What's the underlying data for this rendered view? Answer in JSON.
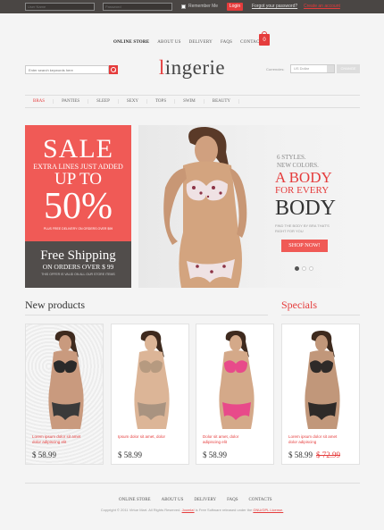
{
  "login_bar": {
    "username_placeholder": "User Name",
    "password_placeholder": "Password",
    "remember_label": "Remember Me",
    "login_label": "Login",
    "forgot_label": "Forgot your password?",
    "create_label": "Create an account"
  },
  "top_nav": {
    "items": [
      "ONLINE STORE",
      "ABOUT US",
      "DELIVERY",
      "FAQS",
      "CONTACTS"
    ],
    "cart_count": "0"
  },
  "search": {
    "placeholder": "Enter search keywords here"
  },
  "logo": {
    "first_letter": "l",
    "rest": "ingerie"
  },
  "currency": {
    "label": "Currencies:",
    "selected": "US Dollar",
    "button": "CHANGE"
  },
  "categories": [
    "BRAS",
    "PANTIES",
    "SLEEP",
    "SEXY",
    "TOPS",
    "SWIM",
    "BEAUTY"
  ],
  "promo_sale": {
    "sale": "SALE",
    "extra": "EXTRA LINES JUST ADDED",
    "upto": "UP TO",
    "percent": "50%",
    "fine": "PLUS FREE DELIVERY ON ORDERS OVER $99"
  },
  "promo_shipping": {
    "title": "Free Shipping",
    "orders": "ON ORDERS OVER $ 99",
    "fine": "THIS OFFER IS VALID ON ALL OUR STORE ITEMS"
  },
  "slider": {
    "styles": "6 STYLES.",
    "colors": "NEW COLORS.",
    "h1": "A BODY",
    "h2": "FOR EVERY",
    "h3": "BODY",
    "find_line1": "FIND THE BODY BY BRA THAT'S",
    "find_line2": "RIGHT FOR YOU",
    "shop": "SHOP NOW!"
  },
  "sections": {
    "new_products": "New products",
    "specials": "Specials"
  },
  "products": [
    {
      "name_line1": "Lorem ipsum dolor sit amet",
      "name_line2": "dolor adipiscing elit",
      "price": "$ 58.99",
      "old_price": "",
      "skin": "#c99a7e",
      "bra": "#2a2a2a",
      "panty": "#3a3a3a"
    },
    {
      "name_line1": "Ipsum dolor sit amet, dolor",
      "name_line2": "",
      "price": "$ 58.99",
      "old_price": "",
      "skin": "#dcb597",
      "bra": "#b69a80",
      "panty": "#a99380"
    },
    {
      "name_line1": "Dolor sit amet, dolor",
      "name_line2": "adipiscing elit",
      "price": "$ 58.99",
      "old_price": "",
      "skin": "#d4a989",
      "bra": "#e84a8a",
      "panty": "#e84a8a"
    },
    {
      "name_line1": "Lorem ipsum dolor sit amet",
      "name_line2": "dolor adipiscing",
      "price": "$ 58.99",
      "old_price": "$ 72.99",
      "skin": "#c1977a",
      "bra": "#2e2a28",
      "panty": "#2e2a28"
    }
  ],
  "footer": {
    "items": [
      "ONLINE STORE",
      "ABOUT US",
      "DELIVERY",
      "FAQS",
      "CONTACTS"
    ],
    "copyright_prefix": "Copyright © 2011 Virtue Mart. All Rights Reserved. ",
    "joomla": "Joomla!",
    "copyright_mid": " is Free Software released under the ",
    "license": "GNU/GPL License."
  },
  "colors": {
    "accent": "#e53c3c",
    "dark": "#4a4644",
    "promo": "#f05a56"
  }
}
